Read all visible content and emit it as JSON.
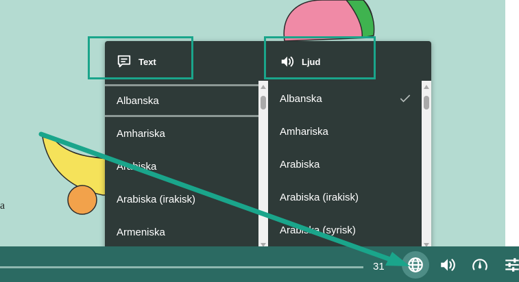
{
  "colors": {
    "background": "#b4dbd1",
    "panel": "#2e3a38",
    "toolbar": "#2b6a62",
    "highlight": "#1aa58b",
    "text": "#ffffff"
  },
  "page": {
    "stray_text": "a"
  },
  "language_menu": {
    "text_column": {
      "header_icon": "comment-text-icon",
      "header_label": "Text",
      "items": [
        "Albanska",
        "Amhariska",
        "Arabiska",
        "Arabiska (irakisk)",
        "Armeniska"
      ],
      "selected": "Albanska"
    },
    "audio_column": {
      "header_icon": "speaker-icon",
      "header_label": "Ljud",
      "items": [
        "Albanska",
        "Amhariska",
        "Arabiska",
        "Arabiska (irakisk)",
        "Arabiska (syrisk)"
      ],
      "selected": "Albanska",
      "selected_icon": "checkmark-icon"
    }
  },
  "toolbar": {
    "page_number": "31",
    "buttons": [
      "globe-icon",
      "speaker-icon",
      "speed-gauge-icon",
      "settings-sliders-icon"
    ],
    "active_button": "globe-icon"
  }
}
